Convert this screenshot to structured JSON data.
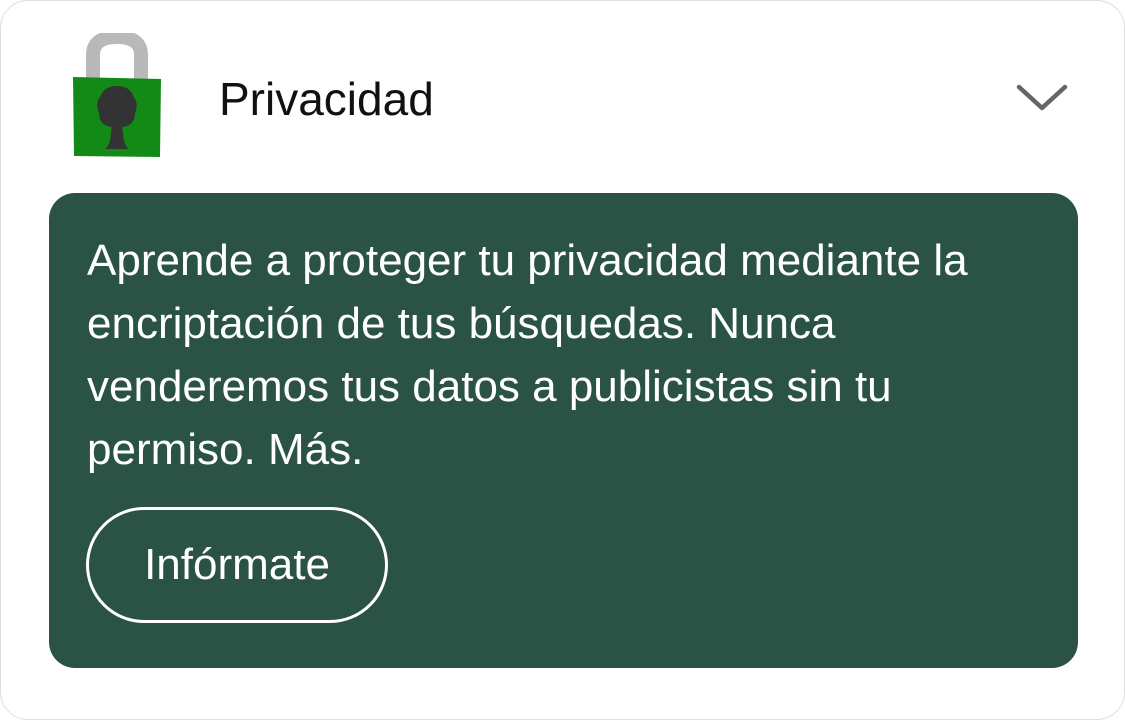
{
  "section": {
    "title": "Privacidad",
    "icon": "lock-tree-icon",
    "chevron_icon": "chevron-down-icon",
    "expanded": true
  },
  "panel": {
    "text": "Aprende a proteger tu privacidad mediante la encriptación de tus búsquedas. Nunca venderemos tus datos a publicistas sin tu permiso. Más.",
    "button_label": "Infórmate"
  },
  "colors": {
    "panel_background": "#2a5345",
    "lock_body": "#138a16",
    "lock_shackle": "#b9b9b9",
    "tree": "#333333",
    "text_dark": "#111111",
    "text_light": "#ffffff",
    "chevron": "#666666"
  }
}
